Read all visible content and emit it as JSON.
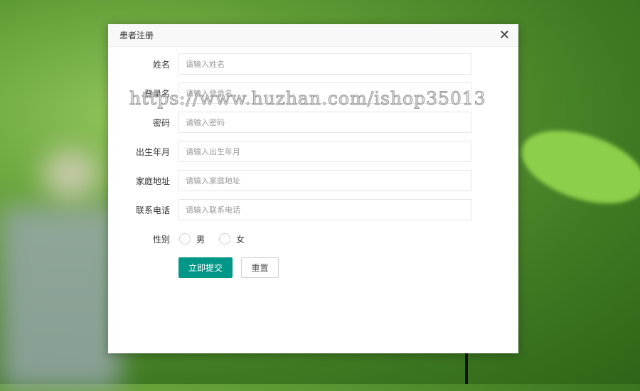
{
  "dialog": {
    "title": "患者注册",
    "close_icon": "close-icon"
  },
  "fields": [
    {
      "label": "姓名",
      "placeholder": "请输入姓名",
      "value": ""
    },
    {
      "label": "登录名",
      "placeholder": "请输入登录名",
      "value": ""
    },
    {
      "label": "密码",
      "placeholder": "请输入密码",
      "value": ""
    },
    {
      "label": "出生年月",
      "placeholder": "请输入出生年月",
      "value": ""
    },
    {
      "label": "家庭地址",
      "placeholder": "请输入家庭地址",
      "value": ""
    },
    {
      "label": "联系电话",
      "placeholder": "请输入联系电话",
      "value": ""
    }
  ],
  "gender": {
    "label": "性别",
    "options": [
      "男",
      "女"
    ]
  },
  "buttons": {
    "submit": "立即提交",
    "reset": "重置"
  },
  "watermark": "https://www.huzhan.com/ishop35013",
  "colors": {
    "primary": "#009688"
  }
}
